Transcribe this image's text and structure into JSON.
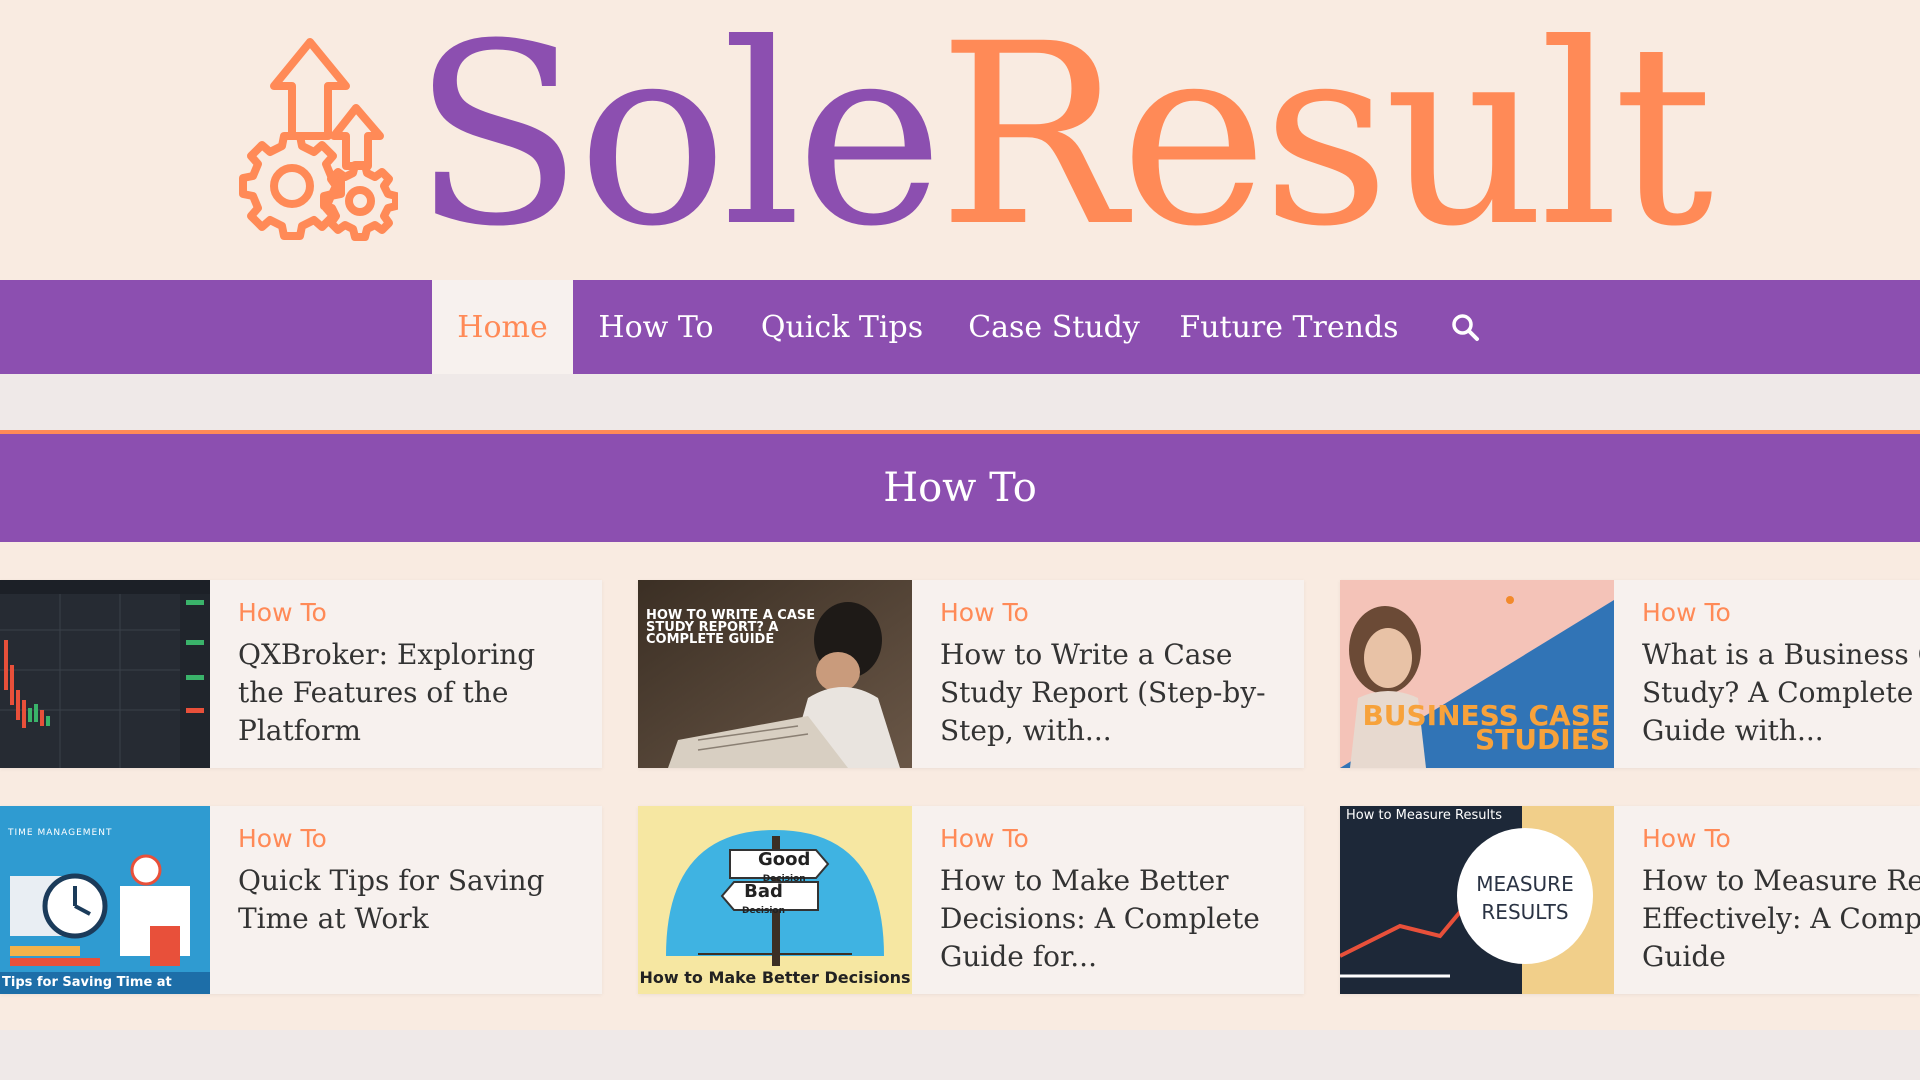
{
  "brand": {
    "name_part1": "Sole",
    "name_part2": "Result",
    "color_purple": "#8c4fb0",
    "color_orange": "#ff8a57"
  },
  "nav": {
    "items": [
      {
        "label": "Home",
        "active": true
      },
      {
        "label": "How To",
        "active": false
      },
      {
        "label": "Quick Tips",
        "active": false
      },
      {
        "label": "Case Study",
        "active": false
      },
      {
        "label": "Future Trends",
        "active": false
      }
    ],
    "search_icon": "search-icon"
  },
  "section": {
    "title": "How To"
  },
  "posts": [
    {
      "category": "How To",
      "title": "QXBroker: Exploring the Features of the Platform",
      "thumb_text": ""
    },
    {
      "category": "How To",
      "title": "How to Write a Case Study Report (Step-by-Step, with...",
      "thumb_text": "HOW TO WRITE A CASE STUDY REPORT? A COMPLETE GUIDE"
    },
    {
      "category": "How To",
      "title": "What is a Business Case Study? A Complete Guide with...",
      "thumb_text": "BUSINESS CASE STUDIES"
    },
    {
      "category": "How To",
      "title": "Quick Tips for Saving Time at Work",
      "thumb_text": "Tips for Saving Time at Work",
      "thumb_header": "TIME MANAGEMENT"
    },
    {
      "category": "How To",
      "title": "How to Make Better Decisions: A Complete Guide for...",
      "thumb_text": "How to Make Better Decisions",
      "sign_top": "Good",
      "sign_top_sub": "Decision",
      "sign_bottom": "Bad",
      "sign_bottom_sub": "Decision"
    },
    {
      "category": "How To",
      "title": "How to Measure Results Effectively: A Complete Guide",
      "thumb_text": "MEASURE RESULTS",
      "thumb_header": "How to Measure Results"
    }
  ]
}
